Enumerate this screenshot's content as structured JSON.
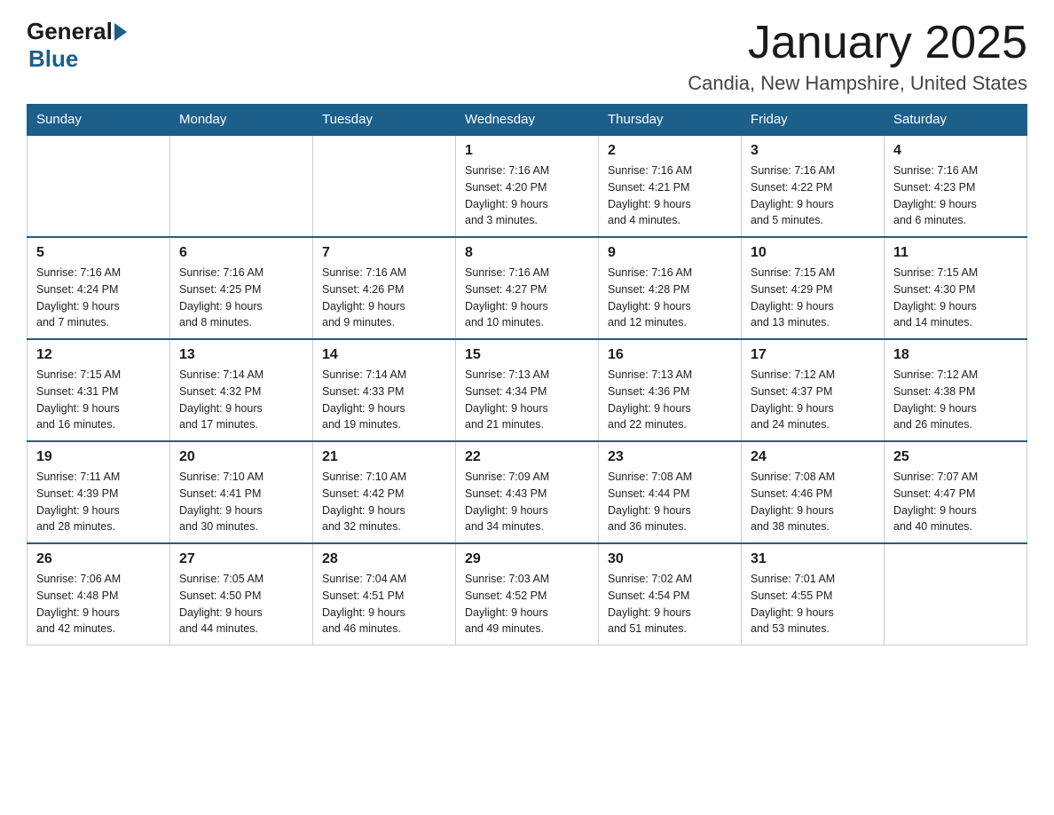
{
  "header": {
    "logo_general": "General",
    "logo_blue": "Blue",
    "title": "January 2025",
    "subtitle": "Candia, New Hampshire, United States"
  },
  "weekdays": [
    "Sunday",
    "Monday",
    "Tuesday",
    "Wednesday",
    "Thursday",
    "Friday",
    "Saturday"
  ],
  "weeks": [
    [
      {
        "day": "",
        "info": ""
      },
      {
        "day": "",
        "info": ""
      },
      {
        "day": "",
        "info": ""
      },
      {
        "day": "1",
        "info": "Sunrise: 7:16 AM\nSunset: 4:20 PM\nDaylight: 9 hours\nand 3 minutes."
      },
      {
        "day": "2",
        "info": "Sunrise: 7:16 AM\nSunset: 4:21 PM\nDaylight: 9 hours\nand 4 minutes."
      },
      {
        "day": "3",
        "info": "Sunrise: 7:16 AM\nSunset: 4:22 PM\nDaylight: 9 hours\nand 5 minutes."
      },
      {
        "day": "4",
        "info": "Sunrise: 7:16 AM\nSunset: 4:23 PM\nDaylight: 9 hours\nand 6 minutes."
      }
    ],
    [
      {
        "day": "5",
        "info": "Sunrise: 7:16 AM\nSunset: 4:24 PM\nDaylight: 9 hours\nand 7 minutes."
      },
      {
        "day": "6",
        "info": "Sunrise: 7:16 AM\nSunset: 4:25 PM\nDaylight: 9 hours\nand 8 minutes."
      },
      {
        "day": "7",
        "info": "Sunrise: 7:16 AM\nSunset: 4:26 PM\nDaylight: 9 hours\nand 9 minutes."
      },
      {
        "day": "8",
        "info": "Sunrise: 7:16 AM\nSunset: 4:27 PM\nDaylight: 9 hours\nand 10 minutes."
      },
      {
        "day": "9",
        "info": "Sunrise: 7:16 AM\nSunset: 4:28 PM\nDaylight: 9 hours\nand 12 minutes."
      },
      {
        "day": "10",
        "info": "Sunrise: 7:15 AM\nSunset: 4:29 PM\nDaylight: 9 hours\nand 13 minutes."
      },
      {
        "day": "11",
        "info": "Sunrise: 7:15 AM\nSunset: 4:30 PM\nDaylight: 9 hours\nand 14 minutes."
      }
    ],
    [
      {
        "day": "12",
        "info": "Sunrise: 7:15 AM\nSunset: 4:31 PM\nDaylight: 9 hours\nand 16 minutes."
      },
      {
        "day": "13",
        "info": "Sunrise: 7:14 AM\nSunset: 4:32 PM\nDaylight: 9 hours\nand 17 minutes."
      },
      {
        "day": "14",
        "info": "Sunrise: 7:14 AM\nSunset: 4:33 PM\nDaylight: 9 hours\nand 19 minutes."
      },
      {
        "day": "15",
        "info": "Sunrise: 7:13 AM\nSunset: 4:34 PM\nDaylight: 9 hours\nand 21 minutes."
      },
      {
        "day": "16",
        "info": "Sunrise: 7:13 AM\nSunset: 4:36 PM\nDaylight: 9 hours\nand 22 minutes."
      },
      {
        "day": "17",
        "info": "Sunrise: 7:12 AM\nSunset: 4:37 PM\nDaylight: 9 hours\nand 24 minutes."
      },
      {
        "day": "18",
        "info": "Sunrise: 7:12 AM\nSunset: 4:38 PM\nDaylight: 9 hours\nand 26 minutes."
      }
    ],
    [
      {
        "day": "19",
        "info": "Sunrise: 7:11 AM\nSunset: 4:39 PM\nDaylight: 9 hours\nand 28 minutes."
      },
      {
        "day": "20",
        "info": "Sunrise: 7:10 AM\nSunset: 4:41 PM\nDaylight: 9 hours\nand 30 minutes."
      },
      {
        "day": "21",
        "info": "Sunrise: 7:10 AM\nSunset: 4:42 PM\nDaylight: 9 hours\nand 32 minutes."
      },
      {
        "day": "22",
        "info": "Sunrise: 7:09 AM\nSunset: 4:43 PM\nDaylight: 9 hours\nand 34 minutes."
      },
      {
        "day": "23",
        "info": "Sunrise: 7:08 AM\nSunset: 4:44 PM\nDaylight: 9 hours\nand 36 minutes."
      },
      {
        "day": "24",
        "info": "Sunrise: 7:08 AM\nSunset: 4:46 PM\nDaylight: 9 hours\nand 38 minutes."
      },
      {
        "day": "25",
        "info": "Sunrise: 7:07 AM\nSunset: 4:47 PM\nDaylight: 9 hours\nand 40 minutes."
      }
    ],
    [
      {
        "day": "26",
        "info": "Sunrise: 7:06 AM\nSunset: 4:48 PM\nDaylight: 9 hours\nand 42 minutes."
      },
      {
        "day": "27",
        "info": "Sunrise: 7:05 AM\nSunset: 4:50 PM\nDaylight: 9 hours\nand 44 minutes."
      },
      {
        "day": "28",
        "info": "Sunrise: 7:04 AM\nSunset: 4:51 PM\nDaylight: 9 hours\nand 46 minutes."
      },
      {
        "day": "29",
        "info": "Sunrise: 7:03 AM\nSunset: 4:52 PM\nDaylight: 9 hours\nand 49 minutes."
      },
      {
        "day": "30",
        "info": "Sunrise: 7:02 AM\nSunset: 4:54 PM\nDaylight: 9 hours\nand 51 minutes."
      },
      {
        "day": "31",
        "info": "Sunrise: 7:01 AM\nSunset: 4:55 PM\nDaylight: 9 hours\nand 53 minutes."
      },
      {
        "day": "",
        "info": ""
      }
    ]
  ]
}
